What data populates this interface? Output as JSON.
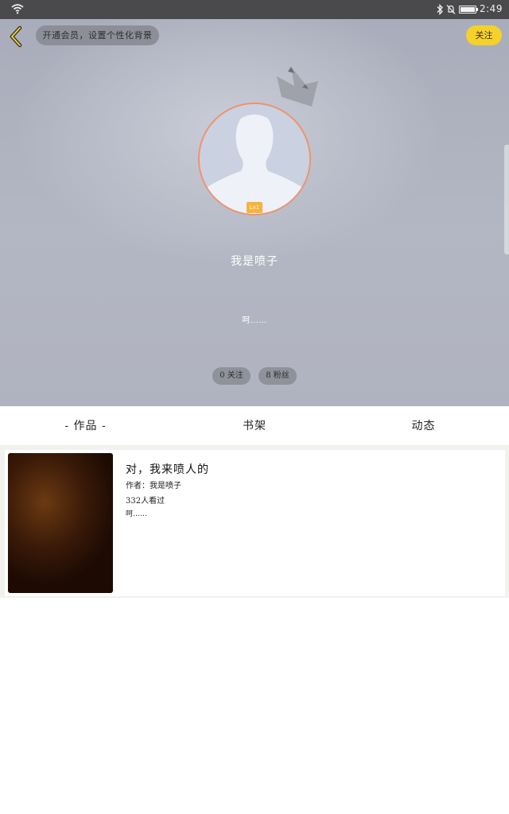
{
  "status_bar": {
    "time": "2:49",
    "icons": [
      "wifi-icon",
      "bluetooth-icon",
      "mute-icon",
      "battery-icon"
    ]
  },
  "header": {
    "vip_banner": "开通会员，设置个性化背景",
    "follow_button": "关注"
  },
  "profile": {
    "level": "Lv1",
    "username": "我是喷子",
    "signature": "呵……",
    "following": "0 关注",
    "fans": "8 粉丝"
  },
  "tabs": [
    {
      "label": "- 作品 -",
      "active": true
    },
    {
      "label": "书架",
      "active": false
    },
    {
      "label": "动态",
      "active": false
    }
  ],
  "works": [
    {
      "title": "对，我来喷人的",
      "author": "作者：我是喷子",
      "views": "332人看过",
      "description": "呵……"
    }
  ],
  "colors": {
    "accent_yellow": "#f5d12a",
    "avatar_ring": "#f0926a",
    "level_badge": "#f3b43d"
  }
}
